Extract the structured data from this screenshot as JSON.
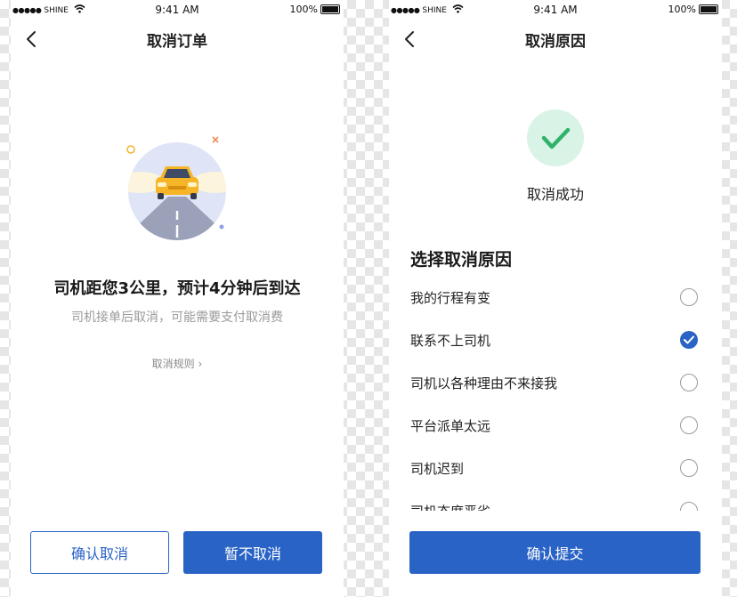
{
  "status_bar": {
    "carrier": "SHINE",
    "time": "9:41 AM",
    "battery": "100%"
  },
  "left_screen": {
    "nav_title": "取消订单",
    "headline": "司机距您3公里，预计4分钟后到达",
    "subline": "司机接单后取消，可能需要支付取消费",
    "rules_link": "取消规则",
    "rules_chevron": "›",
    "confirm_cancel_label": "确认取消",
    "keep_order_label": "暂不取消"
  },
  "right_screen": {
    "nav_title": "取消原因",
    "success_text": "取消成功",
    "section_title": "选择取消原因",
    "reasons": [
      {
        "label": "我的行程有变",
        "checked": false
      },
      {
        "label": "联系不上司机",
        "checked": true
      },
      {
        "label": "司机以各种理由不来接我",
        "checked": false
      },
      {
        "label": "平台派单太远",
        "checked": false
      },
      {
        "label": "司机迟到",
        "checked": false
      },
      {
        "label": "司机态度恶劣",
        "checked": false
      }
    ],
    "submit_label": "确认提交"
  },
  "colors": {
    "primary": "#2a63c6",
    "success_bg": "#d9f3e6",
    "success_check": "#2fb36b"
  }
}
